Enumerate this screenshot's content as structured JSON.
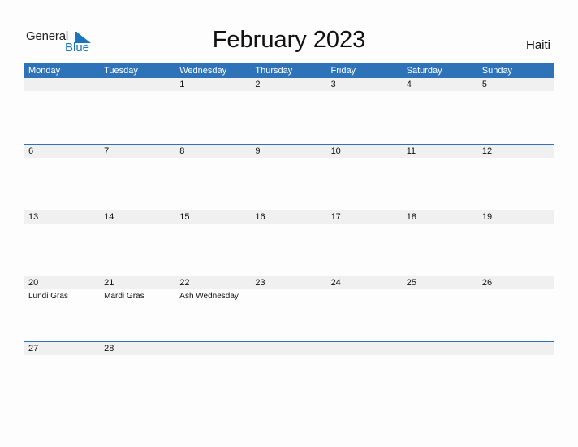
{
  "logo": {
    "line1": "General",
    "line2": "Blue",
    "brand_color": "#1b75bc"
  },
  "title": "February 2023",
  "country": "Haiti",
  "header_color": "#2e73b8",
  "weekdays": [
    "Monday",
    "Tuesday",
    "Wednesday",
    "Thursday",
    "Friday",
    "Saturday",
    "Sunday"
  ],
  "weeks": [
    {
      "days": [
        {
          "num": "",
          "event": ""
        },
        {
          "num": "",
          "event": ""
        },
        {
          "num": "1",
          "event": ""
        },
        {
          "num": "2",
          "event": ""
        },
        {
          "num": "3",
          "event": ""
        },
        {
          "num": "4",
          "event": ""
        },
        {
          "num": "5",
          "event": ""
        }
      ]
    },
    {
      "days": [
        {
          "num": "6",
          "event": ""
        },
        {
          "num": "7",
          "event": ""
        },
        {
          "num": "8",
          "event": ""
        },
        {
          "num": "9",
          "event": ""
        },
        {
          "num": "10",
          "event": ""
        },
        {
          "num": "11",
          "event": ""
        },
        {
          "num": "12",
          "event": ""
        }
      ]
    },
    {
      "days": [
        {
          "num": "13",
          "event": ""
        },
        {
          "num": "14",
          "event": ""
        },
        {
          "num": "15",
          "event": ""
        },
        {
          "num": "16",
          "event": ""
        },
        {
          "num": "17",
          "event": ""
        },
        {
          "num": "18",
          "event": ""
        },
        {
          "num": "19",
          "event": ""
        }
      ]
    },
    {
      "days": [
        {
          "num": "20",
          "event": "Lundi Gras"
        },
        {
          "num": "21",
          "event": "Mardi Gras"
        },
        {
          "num": "22",
          "event": "Ash Wednesday"
        },
        {
          "num": "23",
          "event": ""
        },
        {
          "num": "24",
          "event": ""
        },
        {
          "num": "25",
          "event": ""
        },
        {
          "num": "26",
          "event": ""
        }
      ]
    },
    {
      "days": [
        {
          "num": "27",
          "event": ""
        },
        {
          "num": "28",
          "event": ""
        },
        {
          "num": "",
          "event": ""
        },
        {
          "num": "",
          "event": ""
        },
        {
          "num": "",
          "event": ""
        },
        {
          "num": "",
          "event": ""
        },
        {
          "num": "",
          "event": ""
        }
      ]
    }
  ]
}
